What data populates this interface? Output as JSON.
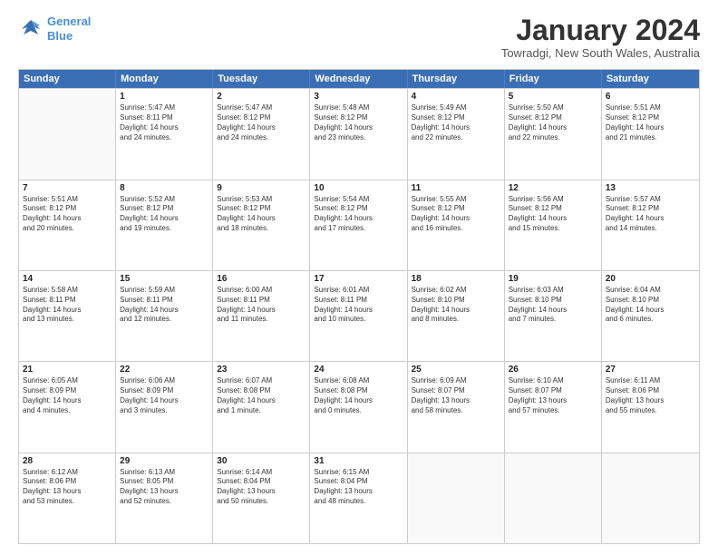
{
  "logo": {
    "line1": "General",
    "line2": "Blue"
  },
  "title": "January 2024",
  "location": "Towradgi, New South Wales, Australia",
  "days_of_week": [
    "Sunday",
    "Monday",
    "Tuesday",
    "Wednesday",
    "Thursday",
    "Friday",
    "Saturday"
  ],
  "weeks": [
    [
      {
        "day": "",
        "empty": true,
        "lines": []
      },
      {
        "day": "1",
        "empty": false,
        "lines": [
          "Sunrise: 5:47 AM",
          "Sunset: 8:11 PM",
          "Daylight: 14 hours",
          "and 24 minutes."
        ]
      },
      {
        "day": "2",
        "empty": false,
        "lines": [
          "Sunrise: 5:47 AM",
          "Sunset: 8:12 PM",
          "Daylight: 14 hours",
          "and 24 minutes."
        ]
      },
      {
        "day": "3",
        "empty": false,
        "lines": [
          "Sunrise: 5:48 AM",
          "Sunset: 8:12 PM",
          "Daylight: 14 hours",
          "and 23 minutes."
        ]
      },
      {
        "day": "4",
        "empty": false,
        "lines": [
          "Sunrise: 5:49 AM",
          "Sunset: 8:12 PM",
          "Daylight: 14 hours",
          "and 22 minutes."
        ]
      },
      {
        "day": "5",
        "empty": false,
        "lines": [
          "Sunrise: 5:50 AM",
          "Sunset: 8:12 PM",
          "Daylight: 14 hours",
          "and 22 minutes."
        ]
      },
      {
        "day": "6",
        "empty": false,
        "lines": [
          "Sunrise: 5:51 AM",
          "Sunset: 8:12 PM",
          "Daylight: 14 hours",
          "and 21 minutes."
        ]
      }
    ],
    [
      {
        "day": "7",
        "empty": false,
        "lines": [
          "Sunrise: 5:51 AM",
          "Sunset: 8:12 PM",
          "Daylight: 14 hours",
          "and 20 minutes."
        ]
      },
      {
        "day": "8",
        "empty": false,
        "lines": [
          "Sunrise: 5:52 AM",
          "Sunset: 8:12 PM",
          "Daylight: 14 hours",
          "and 19 minutes."
        ]
      },
      {
        "day": "9",
        "empty": false,
        "lines": [
          "Sunrise: 5:53 AM",
          "Sunset: 8:12 PM",
          "Daylight: 14 hours",
          "and 18 minutes."
        ]
      },
      {
        "day": "10",
        "empty": false,
        "lines": [
          "Sunrise: 5:54 AM",
          "Sunset: 8:12 PM",
          "Daylight: 14 hours",
          "and 17 minutes."
        ]
      },
      {
        "day": "11",
        "empty": false,
        "lines": [
          "Sunrise: 5:55 AM",
          "Sunset: 8:12 PM",
          "Daylight: 14 hours",
          "and 16 minutes."
        ]
      },
      {
        "day": "12",
        "empty": false,
        "lines": [
          "Sunrise: 5:56 AM",
          "Sunset: 8:12 PM",
          "Daylight: 14 hours",
          "and 15 minutes."
        ]
      },
      {
        "day": "13",
        "empty": false,
        "lines": [
          "Sunrise: 5:57 AM",
          "Sunset: 8:12 PM",
          "Daylight: 14 hours",
          "and 14 minutes."
        ]
      }
    ],
    [
      {
        "day": "14",
        "empty": false,
        "lines": [
          "Sunrise: 5:58 AM",
          "Sunset: 8:11 PM",
          "Daylight: 14 hours",
          "and 13 minutes."
        ]
      },
      {
        "day": "15",
        "empty": false,
        "lines": [
          "Sunrise: 5:59 AM",
          "Sunset: 8:11 PM",
          "Daylight: 14 hours",
          "and 12 minutes."
        ]
      },
      {
        "day": "16",
        "empty": false,
        "lines": [
          "Sunrise: 6:00 AM",
          "Sunset: 8:11 PM",
          "Daylight: 14 hours",
          "and 11 minutes."
        ]
      },
      {
        "day": "17",
        "empty": false,
        "lines": [
          "Sunrise: 6:01 AM",
          "Sunset: 8:11 PM",
          "Daylight: 14 hours",
          "and 10 minutes."
        ]
      },
      {
        "day": "18",
        "empty": false,
        "lines": [
          "Sunrise: 6:02 AM",
          "Sunset: 8:10 PM",
          "Daylight: 14 hours",
          "and 8 minutes."
        ]
      },
      {
        "day": "19",
        "empty": false,
        "lines": [
          "Sunrise: 6:03 AM",
          "Sunset: 8:10 PM",
          "Daylight: 14 hours",
          "and 7 minutes."
        ]
      },
      {
        "day": "20",
        "empty": false,
        "lines": [
          "Sunrise: 6:04 AM",
          "Sunset: 8:10 PM",
          "Daylight: 14 hours",
          "and 6 minutes."
        ]
      }
    ],
    [
      {
        "day": "21",
        "empty": false,
        "lines": [
          "Sunrise: 6:05 AM",
          "Sunset: 8:09 PM",
          "Daylight: 14 hours",
          "and 4 minutes."
        ]
      },
      {
        "day": "22",
        "empty": false,
        "lines": [
          "Sunrise: 6:06 AM",
          "Sunset: 8:09 PM",
          "Daylight: 14 hours",
          "and 3 minutes."
        ]
      },
      {
        "day": "23",
        "empty": false,
        "lines": [
          "Sunrise: 6:07 AM",
          "Sunset: 8:08 PM",
          "Daylight: 14 hours",
          "and 1 minute."
        ]
      },
      {
        "day": "24",
        "empty": false,
        "lines": [
          "Sunrise: 6:08 AM",
          "Sunset: 8:08 PM",
          "Daylight: 14 hours",
          "and 0 minutes."
        ]
      },
      {
        "day": "25",
        "empty": false,
        "lines": [
          "Sunrise: 6:09 AM",
          "Sunset: 8:07 PM",
          "Daylight: 13 hours",
          "and 58 minutes."
        ]
      },
      {
        "day": "26",
        "empty": false,
        "lines": [
          "Sunrise: 6:10 AM",
          "Sunset: 8:07 PM",
          "Daylight: 13 hours",
          "and 57 minutes."
        ]
      },
      {
        "day": "27",
        "empty": false,
        "lines": [
          "Sunrise: 6:11 AM",
          "Sunset: 8:06 PM",
          "Daylight: 13 hours",
          "and 55 minutes."
        ]
      }
    ],
    [
      {
        "day": "28",
        "empty": false,
        "lines": [
          "Sunrise: 6:12 AM",
          "Sunset: 8:06 PM",
          "Daylight: 13 hours",
          "and 53 minutes."
        ]
      },
      {
        "day": "29",
        "empty": false,
        "lines": [
          "Sunrise: 6:13 AM",
          "Sunset: 8:05 PM",
          "Daylight: 13 hours",
          "and 52 minutes."
        ]
      },
      {
        "day": "30",
        "empty": false,
        "lines": [
          "Sunrise: 6:14 AM",
          "Sunset: 8:04 PM",
          "Daylight: 13 hours",
          "and 50 minutes."
        ]
      },
      {
        "day": "31",
        "empty": false,
        "lines": [
          "Sunrise: 6:15 AM",
          "Sunset: 8:04 PM",
          "Daylight: 13 hours",
          "and 48 minutes."
        ]
      },
      {
        "day": "",
        "empty": true,
        "lines": []
      },
      {
        "day": "",
        "empty": true,
        "lines": []
      },
      {
        "day": "",
        "empty": true,
        "lines": []
      }
    ]
  ]
}
